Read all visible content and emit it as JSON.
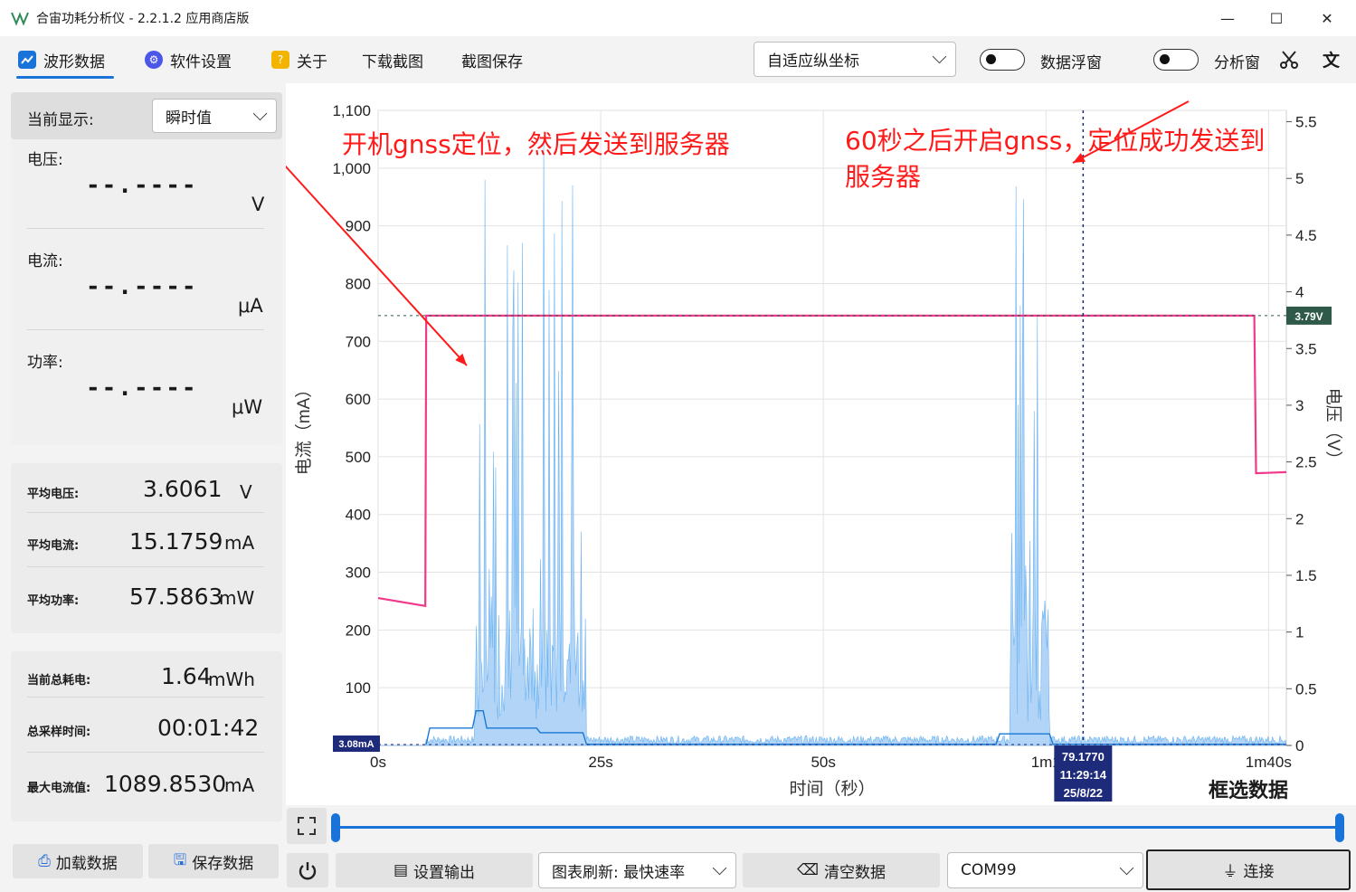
{
  "window": {
    "title": "合宙功耗分析仪 - 2.2.1.2 应用商店版",
    "minimize": "—",
    "maximize": "☐",
    "close": "✕"
  },
  "toolbar": {
    "tabs": [
      {
        "label": "波形数据",
        "icon": "waveform-icon",
        "color": "#1a73d9"
      },
      {
        "label": "软件设置",
        "icon": "gear-icon",
        "color": "#4a57e8"
      },
      {
        "label": "关于",
        "icon": "question-icon",
        "color": "#f3b400"
      },
      {
        "label": "下载截图"
      },
      {
        "label": "截图保存"
      }
    ],
    "y_axis_mode": "自适应纵坐标",
    "data_float_label": "数据浮窗",
    "analysis_window_label": "分析窗",
    "scissors_icon": "scissors-icon",
    "translate_icon": "translate-icon"
  },
  "left": {
    "display_label": "当前显示:",
    "display_mode": "瞬时值",
    "voltage_label": "电压:",
    "voltage_value": "--.----",
    "voltage_unit": "V",
    "current_label": "电流:",
    "current_value": "--.----",
    "current_unit": "μA",
    "power_label": "功率:",
    "power_value": "--.----",
    "power_unit": "μW",
    "stats": [
      {
        "label": "平均电压:",
        "value": "3.6061",
        "unit": "V"
      },
      {
        "label": "平均电流:",
        "value": "15.1759",
        "unit": "mA"
      },
      {
        "label": "平均功率:",
        "value": "57.5863",
        "unit": "mW"
      }
    ],
    "stats2": [
      {
        "label": "当前总耗电:",
        "value": "1.64",
        "unit": "mWh"
      },
      {
        "label": "总采样时间:",
        "value": "00:01:42",
        "unit": ""
      },
      {
        "label": "最大电流值:",
        "value": "1089.8530",
        "unit": "mA"
      }
    ],
    "load_button": "加载数据",
    "save_button": "保存数据"
  },
  "bottom": {
    "set_output": "设置输出",
    "refresh": "图表刷新: 最快速率",
    "clear": "清空数据",
    "port": "COM99",
    "connect": "连接"
  },
  "colors": {
    "current": "#5aaaf0",
    "current_fill": "#a9d0f7",
    "current_avg": "#1a78d6",
    "voltage": "#f0398a",
    "annotation": "#ff1a1a",
    "accent": "#1a73d9"
  },
  "chart_data": {
    "type": "line",
    "xlabel": "时间（秒）",
    "ylabel_left": "电流（mA）",
    "ylabel_right": "电压（V）",
    "x_ticks": [
      "0s",
      "25s",
      "50s",
      "1m1",
      "1m40s"
    ],
    "x_tick_values": [
      0,
      25,
      50,
      75,
      100
    ],
    "xlim": [
      0,
      102
    ],
    "ylim_left": [
      0,
      1100
    ],
    "y_ticks_left": [
      "100",
      "200",
      "300",
      "400",
      "500",
      "600",
      "700",
      "800",
      "900",
      "1,000",
      "1,100"
    ],
    "ylim_right": [
      0,
      5.6
    ],
    "y_ticks_right": [
      "0",
      "0.5",
      "1",
      "1.5",
      "2",
      "2.5",
      "3",
      "3.5",
      "4",
      "4.5",
      "5",
      "5.5"
    ],
    "grid": true,
    "voltage_series": {
      "name": "电压",
      "x": [
        0,
        5.3,
        5.4,
        98.4,
        98.6,
        102
      ],
      "y": [
        1.3,
        1.23,
        3.79,
        3.79,
        2.4,
        2.41
      ]
    },
    "current_series": {
      "name": "电流",
      "idle_ma": 3.08,
      "burst_regions": [
        {
          "x_start": 10.8,
          "x_end": 23.3,
          "max_ma": 1089.85
        },
        {
          "x_start": 71.0,
          "x_end": 75.4,
          "max_ma": 1060
        }
      ]
    },
    "cursor_x": 79.177,
    "cursor_label": "79.1770",
    "cursor_time": "11:29:14",
    "cursor_date": "25/8/22",
    "voltage_marker": "3.79V",
    "current_marker": "3.08mA",
    "select_label": "框选数据",
    "annotations": [
      "开机gnss定位，然后发送到服务器",
      "60秒之后开启gnss，定位成功发送到服务器"
    ]
  }
}
